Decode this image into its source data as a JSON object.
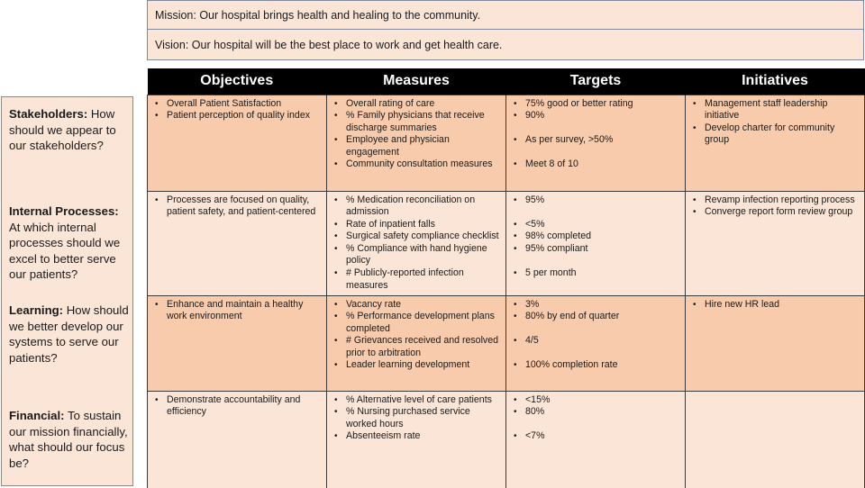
{
  "mission": "Mission: Our hospital brings health and healing to the community.",
  "vision": "Vision: Our hospital will be the best place to work and get health care.",
  "columns": [
    "Objectives",
    "Measures",
    "Targets",
    "Initiatives"
  ],
  "perspectives": [
    {
      "label": "Stakeholders:",
      "question": " How should we appear to our stakeholders?"
    },
    {
      "label": "Internal Processes:",
      "question": " At which internal processes should we excel to better serve our patients?"
    },
    {
      "label": "Learning:",
      "question": " How should we better develop our systems to serve our patients?"
    },
    {
      "label": "Financial:",
      "question": " To sustain our mission financially, what should our focus be?"
    }
  ],
  "rows": [
    {
      "objectives": [
        "Overall Patient Satisfaction",
        "Patient perception of quality index"
      ],
      "measures": [
        "Overall rating of care",
        "% Family physicians that receive discharge summaries",
        "Employee and physician engagement",
        "Community consultation measures"
      ],
      "targets": [
        "75% good or better rating",
        "90%",
        "As per survey, >50%",
        "Meet 8 of 10"
      ],
      "initiatives": [
        "Management staff leadership initiative",
        "Develop charter for community group"
      ]
    },
    {
      "objectives": [
        "Processes are focused on quality, patient safety, and patient-centered"
      ],
      "measures": [
        "% Medication reconciliation on admission",
        "Rate of inpatient falls",
        "Surgical safety compliance checklist",
        "% Compliance with hand hygiene policy",
        "# Publicly-reported infection measures"
      ],
      "targets": [
        "95%",
        "<5%",
        "98% completed",
        "95% compliant",
        "5 per month"
      ],
      "initiatives": [
        "Revamp infection reporting process",
        "Converge report form review group"
      ]
    },
    {
      "objectives": [
        "Enhance and maintain a healthy work environment"
      ],
      "measures": [
        "Vacancy rate",
        "% Performance development plans completed",
        "# Grievances received and resolved prior to arbitration",
        "Leader learning development"
      ],
      "targets": [
        "3%",
        "80% by end of quarter",
        "4/5",
        "100% completion rate"
      ],
      "initiatives": [
        "Hire new HR lead"
      ]
    },
    {
      "objectives": [
        "Demonstrate accountability and efficiency"
      ],
      "measures": [
        "% Alternative level of care patients",
        "% Nursing purchased service worked hours",
        "Absenteeism rate"
      ],
      "targets": [
        "<15%",
        "80%",
        "<7%"
      ],
      "initiatives": []
    }
  ]
}
